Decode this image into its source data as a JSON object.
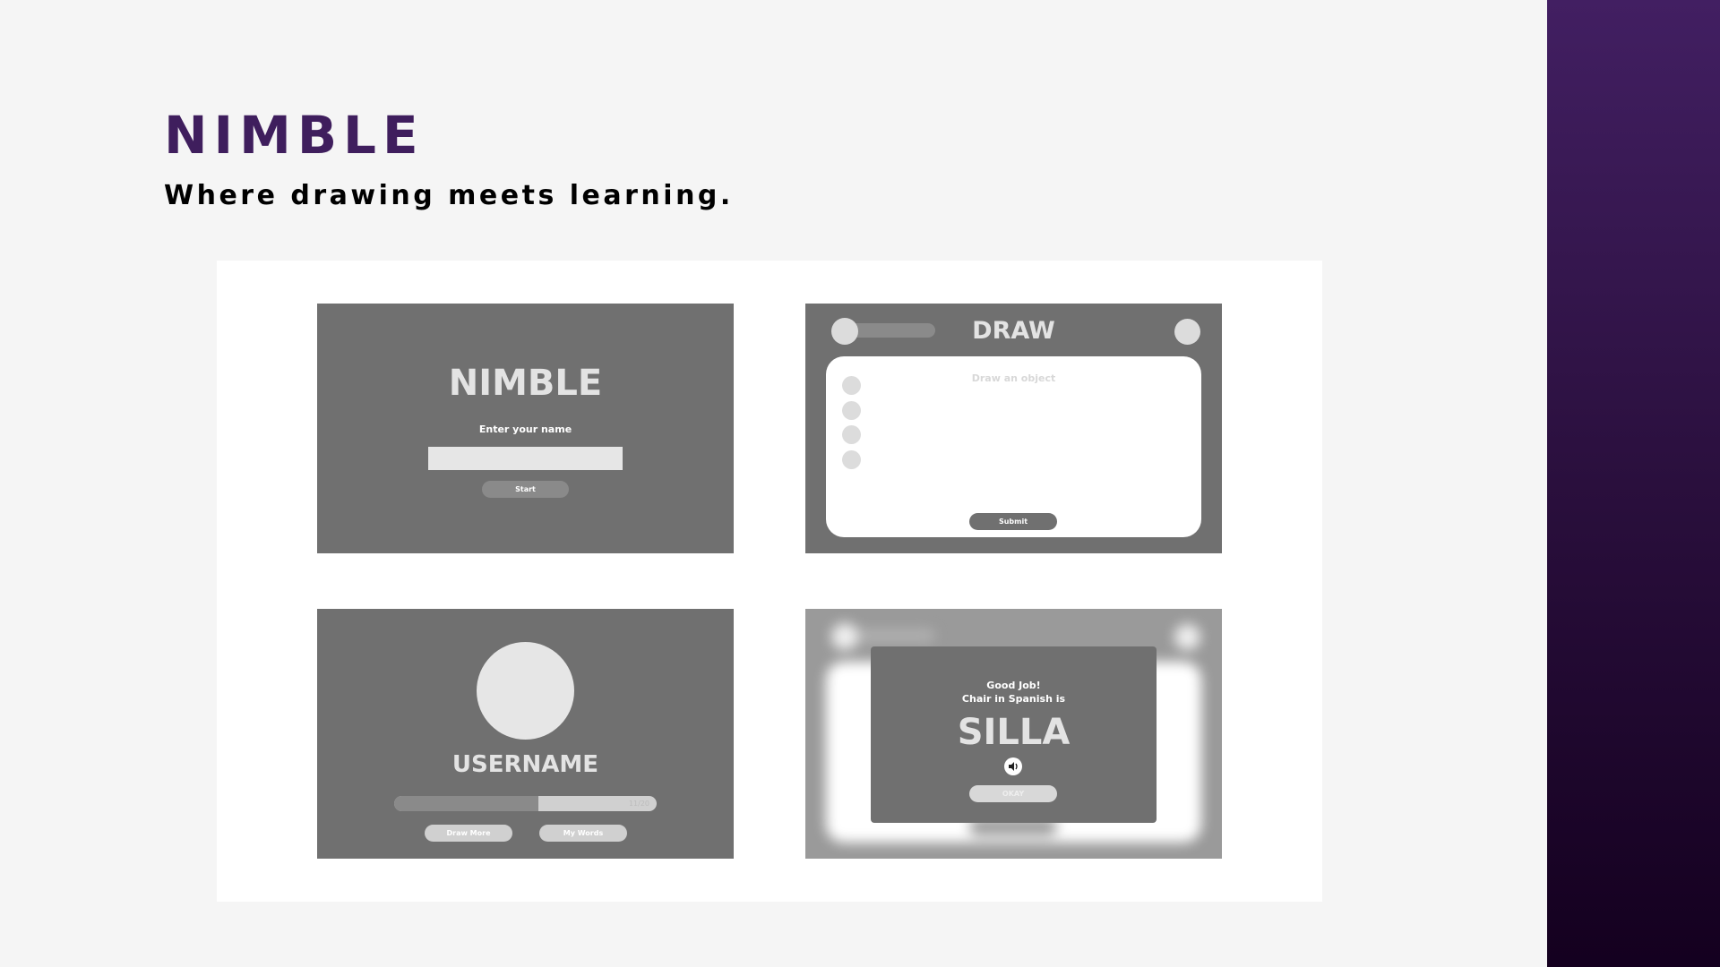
{
  "slide": {
    "title": "NIMBLE",
    "subtitle": "Where drawing meets learning."
  },
  "mock_login": {
    "app_title": "NIMBLE",
    "prompt": "Enter your name",
    "name_input_value": "",
    "start_label": "Start"
  },
  "mock_draw": {
    "header": "DRAW",
    "canvas_hint": "Draw an object",
    "submit_label": "Submit",
    "tool_count": 4
  },
  "mock_profile": {
    "username": "USERNAME",
    "progress_fraction": 0.55,
    "progress_text": "11/20",
    "draw_more_label": "Draw More",
    "my_words_label": "My Words"
  },
  "mock_result": {
    "line1": "Good Job!",
    "line2": "Chair in Spanish is",
    "word": "SILLA",
    "speaker_icon": "speaker-icon",
    "okay_label": "OKAY"
  },
  "colors": {
    "brand_purple": "#3f1e5d",
    "mock_gray": "#707070",
    "light_gray": "#e3e3e3",
    "side_band_top": "#421f62",
    "side_band_bottom": "#14001f"
  }
}
